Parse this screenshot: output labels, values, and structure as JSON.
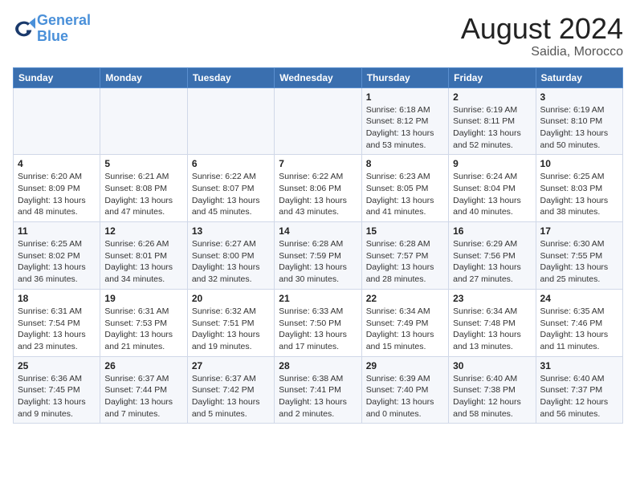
{
  "logo": {
    "line1": "General",
    "line2": "Blue"
  },
  "title": "August 2024",
  "subtitle": "Saidia, Morocco",
  "days_of_week": [
    "Sunday",
    "Monday",
    "Tuesday",
    "Wednesday",
    "Thursday",
    "Friday",
    "Saturday"
  ],
  "weeks": [
    [
      {
        "day": "",
        "info": ""
      },
      {
        "day": "",
        "info": ""
      },
      {
        "day": "",
        "info": ""
      },
      {
        "day": "",
        "info": ""
      },
      {
        "day": "1",
        "info": "Sunrise: 6:18 AM\nSunset: 8:12 PM\nDaylight: 13 hours\nand 53 minutes."
      },
      {
        "day": "2",
        "info": "Sunrise: 6:19 AM\nSunset: 8:11 PM\nDaylight: 13 hours\nand 52 minutes."
      },
      {
        "day": "3",
        "info": "Sunrise: 6:19 AM\nSunset: 8:10 PM\nDaylight: 13 hours\nand 50 minutes."
      }
    ],
    [
      {
        "day": "4",
        "info": "Sunrise: 6:20 AM\nSunset: 8:09 PM\nDaylight: 13 hours\nand 48 minutes."
      },
      {
        "day": "5",
        "info": "Sunrise: 6:21 AM\nSunset: 8:08 PM\nDaylight: 13 hours\nand 47 minutes."
      },
      {
        "day": "6",
        "info": "Sunrise: 6:22 AM\nSunset: 8:07 PM\nDaylight: 13 hours\nand 45 minutes."
      },
      {
        "day": "7",
        "info": "Sunrise: 6:22 AM\nSunset: 8:06 PM\nDaylight: 13 hours\nand 43 minutes."
      },
      {
        "day": "8",
        "info": "Sunrise: 6:23 AM\nSunset: 8:05 PM\nDaylight: 13 hours\nand 41 minutes."
      },
      {
        "day": "9",
        "info": "Sunrise: 6:24 AM\nSunset: 8:04 PM\nDaylight: 13 hours\nand 40 minutes."
      },
      {
        "day": "10",
        "info": "Sunrise: 6:25 AM\nSunset: 8:03 PM\nDaylight: 13 hours\nand 38 minutes."
      }
    ],
    [
      {
        "day": "11",
        "info": "Sunrise: 6:25 AM\nSunset: 8:02 PM\nDaylight: 13 hours\nand 36 minutes."
      },
      {
        "day": "12",
        "info": "Sunrise: 6:26 AM\nSunset: 8:01 PM\nDaylight: 13 hours\nand 34 minutes."
      },
      {
        "day": "13",
        "info": "Sunrise: 6:27 AM\nSunset: 8:00 PM\nDaylight: 13 hours\nand 32 minutes."
      },
      {
        "day": "14",
        "info": "Sunrise: 6:28 AM\nSunset: 7:59 PM\nDaylight: 13 hours\nand 30 minutes."
      },
      {
        "day": "15",
        "info": "Sunrise: 6:28 AM\nSunset: 7:57 PM\nDaylight: 13 hours\nand 28 minutes."
      },
      {
        "day": "16",
        "info": "Sunrise: 6:29 AM\nSunset: 7:56 PM\nDaylight: 13 hours\nand 27 minutes."
      },
      {
        "day": "17",
        "info": "Sunrise: 6:30 AM\nSunset: 7:55 PM\nDaylight: 13 hours\nand 25 minutes."
      }
    ],
    [
      {
        "day": "18",
        "info": "Sunrise: 6:31 AM\nSunset: 7:54 PM\nDaylight: 13 hours\nand 23 minutes."
      },
      {
        "day": "19",
        "info": "Sunrise: 6:31 AM\nSunset: 7:53 PM\nDaylight: 13 hours\nand 21 minutes."
      },
      {
        "day": "20",
        "info": "Sunrise: 6:32 AM\nSunset: 7:51 PM\nDaylight: 13 hours\nand 19 minutes."
      },
      {
        "day": "21",
        "info": "Sunrise: 6:33 AM\nSunset: 7:50 PM\nDaylight: 13 hours\nand 17 minutes."
      },
      {
        "day": "22",
        "info": "Sunrise: 6:34 AM\nSunset: 7:49 PM\nDaylight: 13 hours\nand 15 minutes."
      },
      {
        "day": "23",
        "info": "Sunrise: 6:34 AM\nSunset: 7:48 PM\nDaylight: 13 hours\nand 13 minutes."
      },
      {
        "day": "24",
        "info": "Sunrise: 6:35 AM\nSunset: 7:46 PM\nDaylight: 13 hours\nand 11 minutes."
      }
    ],
    [
      {
        "day": "25",
        "info": "Sunrise: 6:36 AM\nSunset: 7:45 PM\nDaylight: 13 hours\nand 9 minutes."
      },
      {
        "day": "26",
        "info": "Sunrise: 6:37 AM\nSunset: 7:44 PM\nDaylight: 13 hours\nand 7 minutes."
      },
      {
        "day": "27",
        "info": "Sunrise: 6:37 AM\nSunset: 7:42 PM\nDaylight: 13 hours\nand 5 minutes."
      },
      {
        "day": "28",
        "info": "Sunrise: 6:38 AM\nSunset: 7:41 PM\nDaylight: 13 hours\nand 2 minutes."
      },
      {
        "day": "29",
        "info": "Sunrise: 6:39 AM\nSunset: 7:40 PM\nDaylight: 13 hours\nand 0 minutes."
      },
      {
        "day": "30",
        "info": "Sunrise: 6:40 AM\nSunset: 7:38 PM\nDaylight: 12 hours\nand 58 minutes."
      },
      {
        "day": "31",
        "info": "Sunrise: 6:40 AM\nSunset: 7:37 PM\nDaylight: 12 hours\nand 56 minutes."
      }
    ]
  ]
}
